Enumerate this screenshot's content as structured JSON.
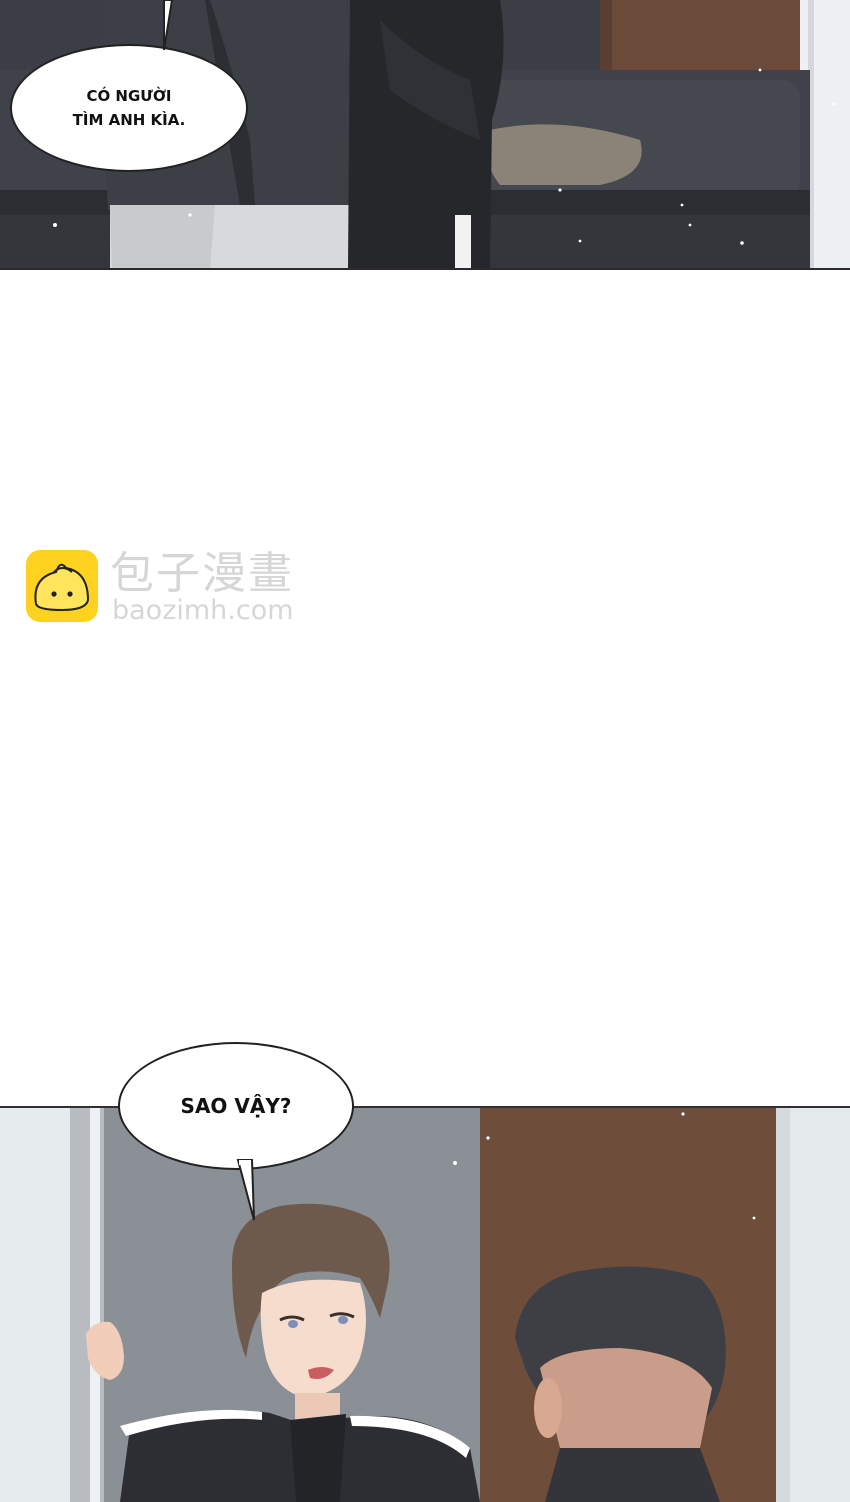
{
  "panels": {
    "top": {
      "bubble_lines": [
        "CÓ NGƯỜI",
        "TÌM ANH KÌA."
      ]
    },
    "bottom": {
      "bubble_text": "SAO VẬY?"
    }
  },
  "watermark": {
    "brand_cn": "包子漫畫",
    "domain": "baozimh.com",
    "logo_icon": "bun-mascot-icon",
    "logo_color": "#ffd21f",
    "text_color": "#d6d6d6"
  }
}
